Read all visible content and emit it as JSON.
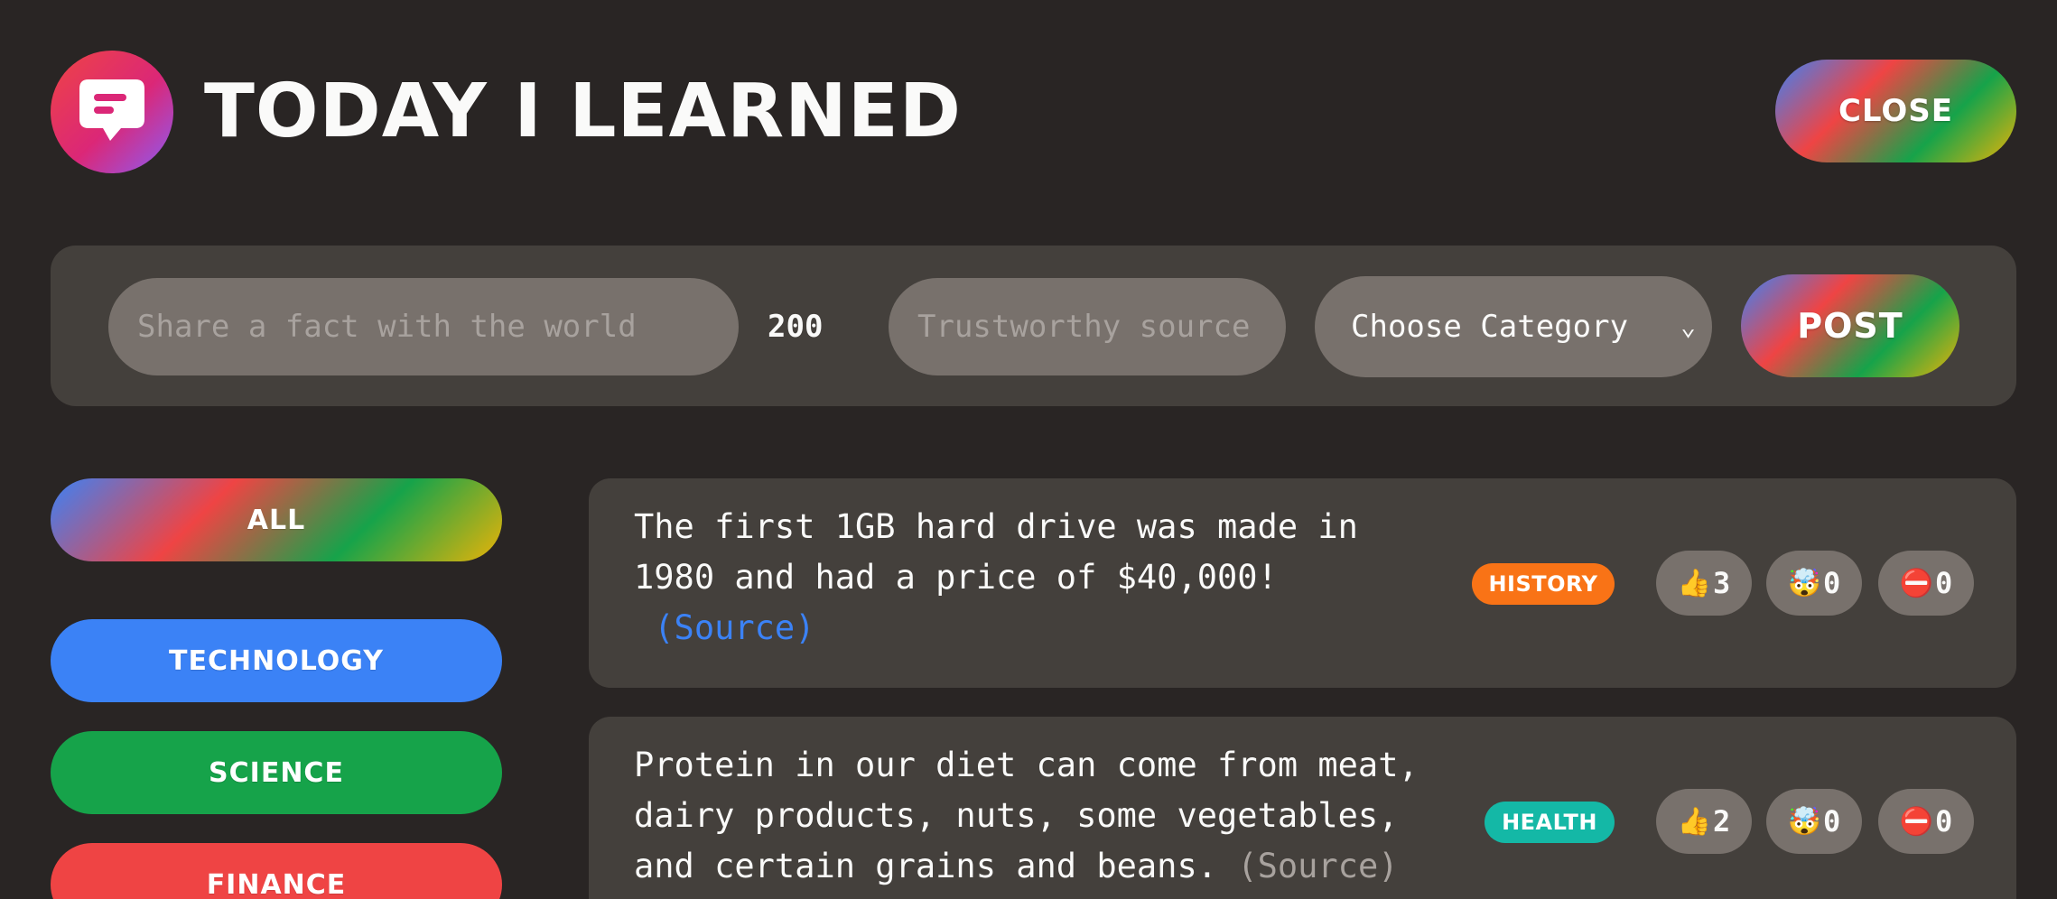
{
  "header": {
    "title": "Today I Learned",
    "close_label": "Close",
    "logo_icon": "chat-bubble-icon"
  },
  "form": {
    "fact_placeholder": "Share a fact with the world",
    "fact_value": "",
    "char_count": "200",
    "source_placeholder": "Trustworthy source",
    "source_value": "",
    "category_selected": "Choose Category",
    "post_label": "Post"
  },
  "sidebar": {
    "items": [
      {
        "label": "All",
        "color": "gradient"
      },
      {
        "label": "Technology",
        "color": "#3b82f6"
      },
      {
        "label": "Science",
        "color": "#16a34a"
      },
      {
        "label": "Finance",
        "color": "#ef4444"
      }
    ]
  },
  "facts": [
    {
      "text_line1": "The first 1GB hard drive was made in",
      "text_line2": "1980 and had a price of $40,000!",
      "source_label": "(Source)",
      "source_color": "#3b82f6",
      "category": "History",
      "category_color": "#f97316",
      "votes_interesting": "3",
      "votes_mindblowing": "0",
      "votes_false": "0"
    },
    {
      "text_line1": "Protein in our diet can come from meat,",
      "text_line2": "dairy products, nuts, some vegetables,",
      "text_line3": "and certain grains and beans.",
      "source_label": "(Source)",
      "source_color": "#a8a29e",
      "category": "Health",
      "category_color": "#14b8a6",
      "votes_interesting": "2",
      "votes_mindblowing": "0",
      "votes_false": "0"
    }
  ],
  "vote_icons": {
    "interesting": "👍",
    "mindblowing": "🤯",
    "false": "⛔️"
  }
}
